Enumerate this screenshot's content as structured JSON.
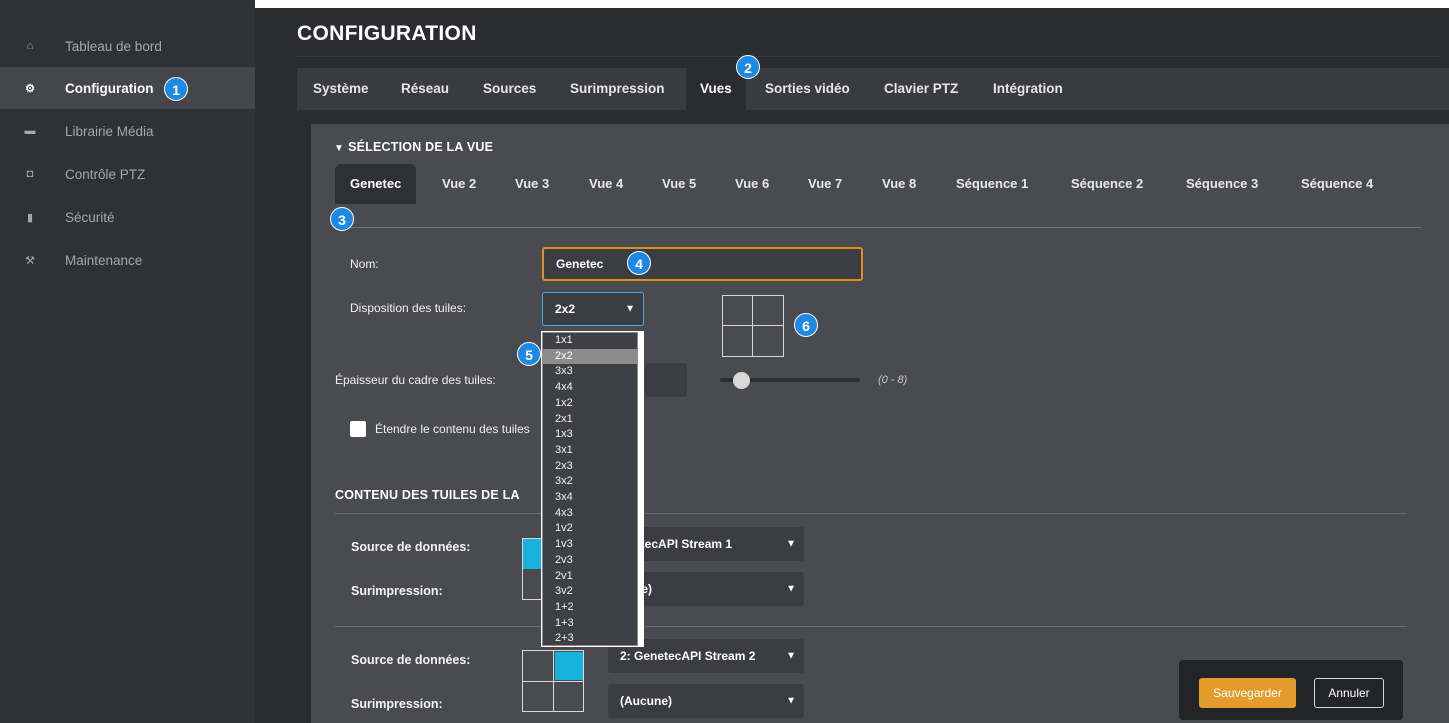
{
  "sidebar": {
    "items": [
      {
        "label": "Tableau de bord",
        "icon": "home-icon",
        "glyph": "⌂"
      },
      {
        "label": "Configuration",
        "icon": "gear-icon",
        "glyph": "⚙"
      },
      {
        "label": "Librairie Média",
        "icon": "folder-icon",
        "glyph": "▬"
      },
      {
        "label": "Contrôle PTZ",
        "icon": "ptz-camera-icon",
        "glyph": "◘"
      },
      {
        "label": "Sécurité",
        "icon": "lock-icon",
        "glyph": "▮"
      },
      {
        "label": "Maintenance",
        "icon": "wrench-icon",
        "glyph": "⚒"
      }
    ]
  },
  "header": {
    "title": "CONFIGURATION"
  },
  "tabs": [
    "Système",
    "Réseau",
    "Sources",
    "Surimpression",
    "Vues",
    "Sorties vidéo",
    "Clavier PTZ",
    "Intégration"
  ],
  "view_selection": {
    "heading": "SÉLECTION DE LA VUE",
    "view_tabs": [
      "Genetec",
      "Vue 2",
      "Vue 3",
      "Vue 4",
      "Vue 5",
      "Vue 6",
      "Vue 7",
      "Vue 8",
      "Séquence 1",
      "Séquence 2",
      "Séquence 3",
      "Séquence 4"
    ],
    "name_label": "Nom:",
    "name_value": "Genetec",
    "layout_label": "Disposition des tuiles:",
    "layout_value": "2x2",
    "layout_options": [
      "1x1",
      "2x2",
      "3x3",
      "4x4",
      "1x2",
      "2x1",
      "1x3",
      "3x1",
      "2x3",
      "3x2",
      "3x4",
      "4x3",
      "1v2",
      "1v3",
      "2v3",
      "2v1",
      "3v2",
      "1+2",
      "1+3",
      "2+3"
    ],
    "layout_highlighted": "2x2",
    "border_label": "Épaisseur du cadre des tuiles:",
    "border_value": 0,
    "border_range": "(0 - 8)",
    "stretch_label": "Étendre le contenu des tuiles",
    "stretch_checked": false
  },
  "tile_content": {
    "heading": "CONTENU DES TUILES DE LA",
    "rows": [
      {
        "source_label": "Source de données:",
        "source_value": "enetecAPI Stream 1",
        "overlay_label": "Surimpression:",
        "overlay_value": "cune)"
      },
      {
        "source_label": "Source de données:",
        "source_value": "2: GenetecAPI Stream 2",
        "overlay_label": "Surimpression:",
        "overlay_value": "(Aucune)"
      }
    ]
  },
  "badges": [
    "1",
    "2",
    "3",
    "4",
    "5",
    "6"
  ],
  "actions": {
    "save": "Sauvegarder",
    "cancel": "Annuler"
  },
  "colors": {
    "accent": "#e39b2b",
    "highlight_blue": "#16b4dc",
    "badge": "#1e88e5"
  }
}
